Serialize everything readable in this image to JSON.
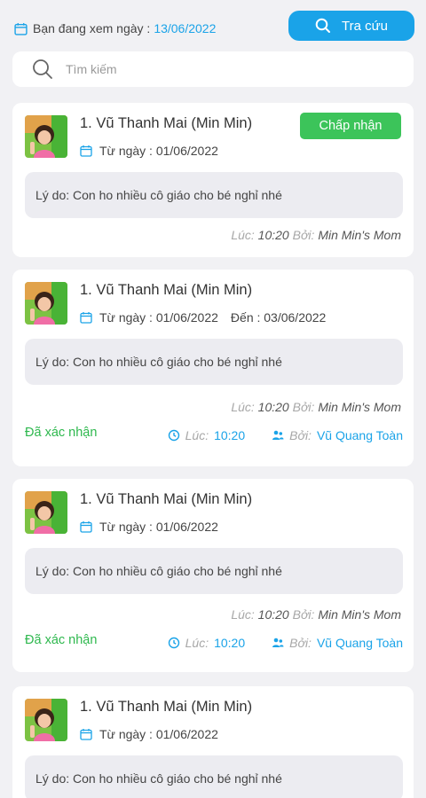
{
  "header": {
    "viewing_label": "Bạn đang xem ngày :",
    "viewing_date": "13/06/2022",
    "lookup_button": "Tra cứu"
  },
  "search": {
    "placeholder": "Tìm kiếm"
  },
  "colors": {
    "accent": "#1aa3e8",
    "accept": "#3cc45a",
    "confirmed": "#2eb84e",
    "background": "#f1f1f4"
  },
  "icons": {
    "calendar": "calendar-icon",
    "search": "search-icon",
    "clock": "clock-icon",
    "user": "user-icon"
  },
  "cards": [
    {
      "name": "1. Vũ Thanh Mai (Min Min)",
      "from": "Từ ngày : 01/06/2022",
      "to": "",
      "accept_label": "Chấp nhận",
      "reason": "Lý do: Con ho nhiều cô giáo cho bé nghỉ nhé",
      "time_label": "Lúc:",
      "time": "10:20",
      "by_label": "Bởi:",
      "by": "Min Min's Mom"
    },
    {
      "name": "1. Vũ Thanh Mai (Min Min)",
      "from": "Từ ngày : 01/06/2022",
      "to": "Đến : 03/06/2022",
      "reason": "Lý do: Con ho nhiều cô giáo cho bé nghỉ nhé",
      "time_label": "Lúc:",
      "time": "10:20",
      "by_label": "Bởi:",
      "by": "Min Min's Mom",
      "status": "Đã xác nhận",
      "confirm_time_label": "Lúc:",
      "confirm_time": "10:20",
      "confirm_by_label": "Bởi:",
      "confirm_by": "Vũ Quang Toàn"
    },
    {
      "name": "1. Vũ Thanh Mai (Min Min)",
      "from": "Từ ngày : 01/06/2022",
      "to": "",
      "reason": "Lý do: Con ho nhiều cô giáo cho bé nghỉ nhé",
      "time_label": "Lúc:",
      "time": "10:20",
      "by_label": "Bởi:",
      "by": "Min Min's Mom",
      "status": "Đã xác nhận",
      "confirm_time_label": "Lúc:",
      "confirm_time": "10:20",
      "confirm_by_label": "Bởi:",
      "confirm_by": "Vũ Quang Toàn"
    },
    {
      "name": "1. Vũ Thanh Mai (Min Min)",
      "from": "Từ ngày : 01/06/2022",
      "to": "",
      "reason": "Lý do: Con ho nhiều cô giáo cho bé nghỉ nhé"
    }
  ]
}
